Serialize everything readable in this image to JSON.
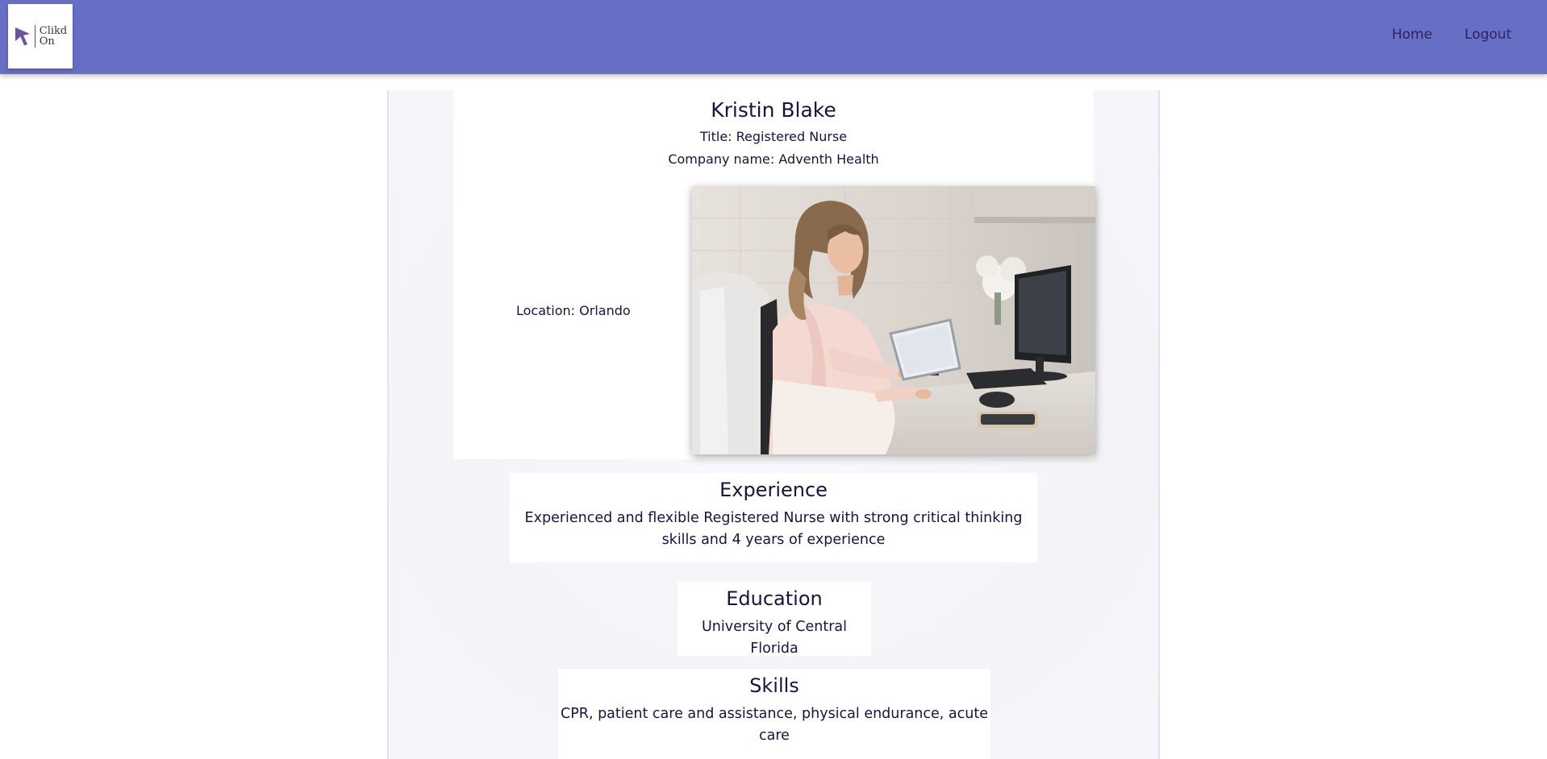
{
  "nav": {
    "logo_text_line1": "Clikd",
    "logo_text_line2": "On",
    "home_label": "Home",
    "logout_label": "Logout",
    "bar_color": "#666fc3"
  },
  "profile": {
    "name": "Kristin Blake",
    "title_line": "Title: Registered Nurse",
    "company_line": "Company name: Adventh Health",
    "location_line": "Location: Orlando",
    "photo_alt": "Profile photo"
  },
  "sections": {
    "experience": {
      "heading": "Experience",
      "text": "Experienced and flexible Registered Nurse with strong critical thinking skills and 4 years of experience"
    },
    "education": {
      "heading": "Education",
      "text": "University of Central Florida"
    },
    "skills": {
      "heading": "Skills",
      "text": "CPR, patient care and assistance, physical endurance, acute care"
    }
  },
  "icons": {
    "logo": "cursor-arrow-icon"
  }
}
